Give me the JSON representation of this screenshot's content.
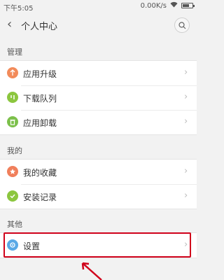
{
  "status_bar": {
    "time": "下午5:05",
    "speed": "0.00K/s",
    "battery_level": 0.7
  },
  "header": {
    "title": "个人中心"
  },
  "sections": [
    {
      "title": "管理",
      "items": [
        {
          "label": "应用升级",
          "icon": "upgrade-icon",
          "color": "#f28b5a"
        },
        {
          "label": "下载队列",
          "icon": "download-queue-icon",
          "color": "#8cc63f"
        },
        {
          "label": "应用卸载",
          "icon": "uninstall-icon",
          "color": "#7cc04b"
        }
      ]
    },
    {
      "title": "我的",
      "items": [
        {
          "label": "我的收藏",
          "icon": "star-icon",
          "color": "#f07f5b"
        },
        {
          "label": "安装记录",
          "icon": "check-icon",
          "color": "#8cc63f"
        }
      ]
    },
    {
      "title": "其他",
      "items": [
        {
          "label": "设置",
          "icon": "settings-icon",
          "color": "#5aa9e6"
        }
      ]
    }
  ],
  "colors": {
    "highlight": "#d0021b",
    "background": "#f2f2f2"
  }
}
